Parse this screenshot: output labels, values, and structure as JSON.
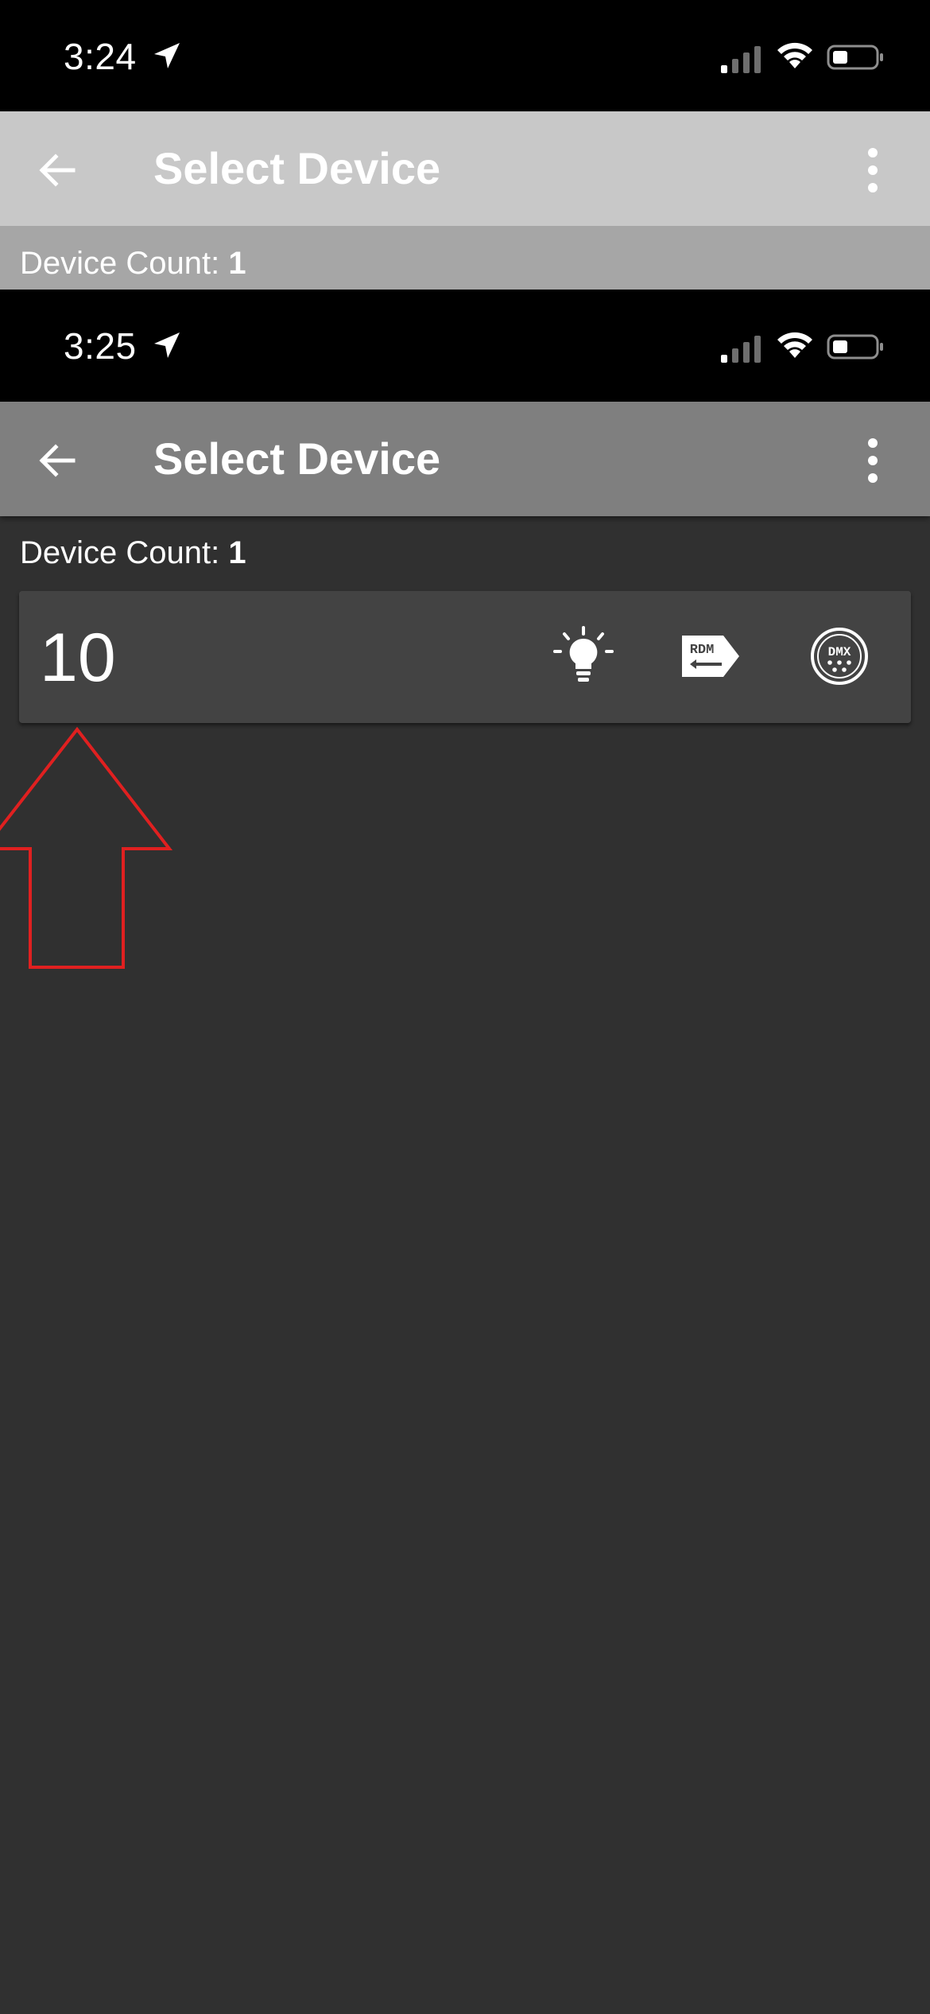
{
  "frames": [
    {
      "status_bar": {
        "time": "3:24"
      },
      "app_bar": {
        "title": "Select Device"
      },
      "device_count": {
        "label": "Device Count:",
        "value": "1"
      }
    },
    {
      "status_bar": {
        "time": "3:25"
      },
      "app_bar": {
        "title": "Select Device"
      },
      "device_count": {
        "label": "Device Count:",
        "value": "1"
      }
    }
  ],
  "devices": [
    {
      "id": "10",
      "icons": [
        "lightbulb-icon",
        "rdm-icon",
        "dmx-icon"
      ]
    }
  ],
  "colors": {
    "status_bar": "#000000",
    "app_bar_faded": "#c8c8c8",
    "app_bar": "#7f7f7f",
    "background": "#303030",
    "card": "#434343",
    "annotation_arrow": "#e02020"
  }
}
